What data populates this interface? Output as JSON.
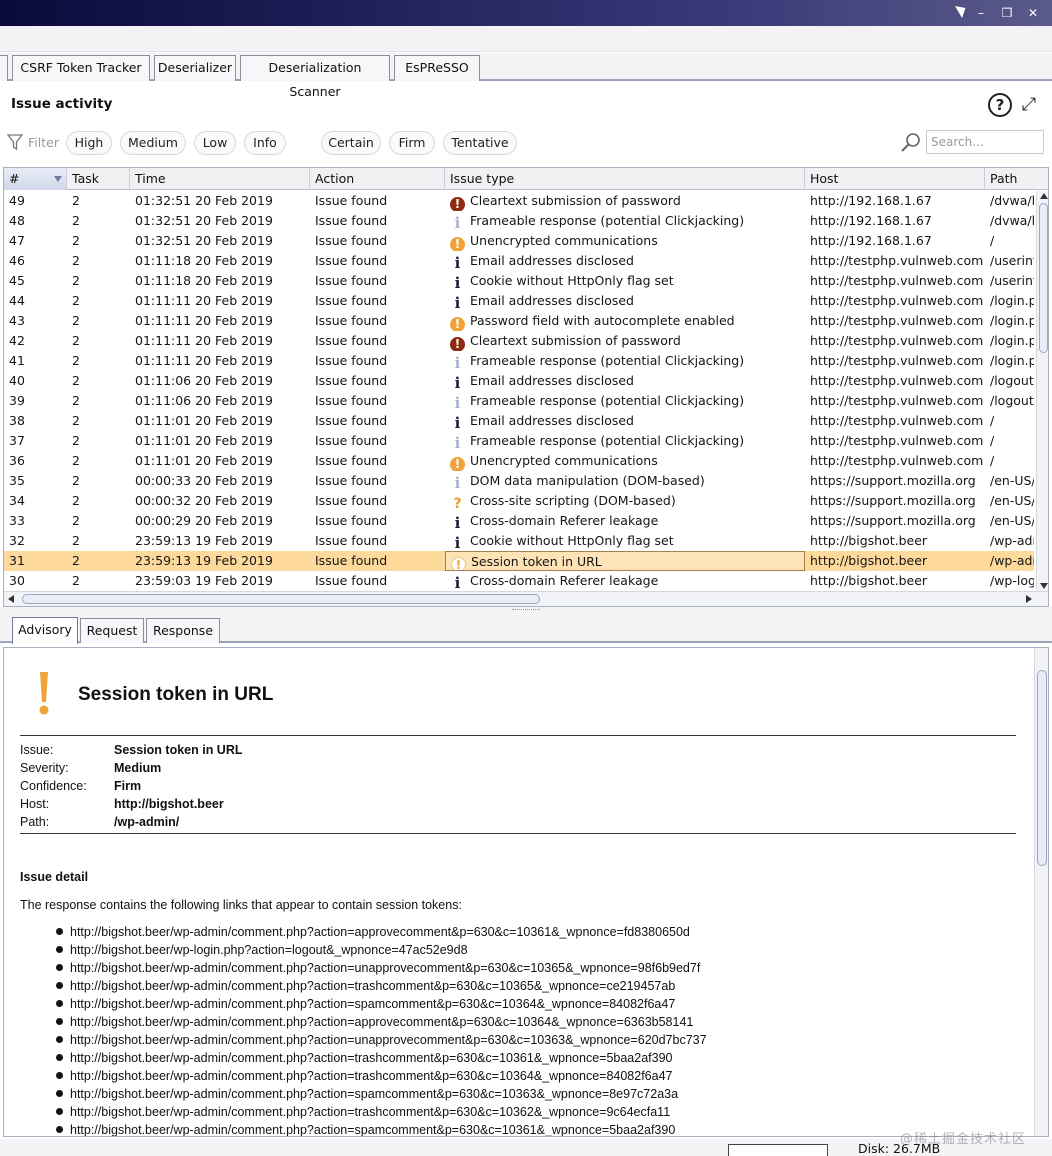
{
  "window": {
    "minimize": "–",
    "restore": "❐",
    "close": "✕"
  },
  "top_tabs": [
    "CSRF Token Tracker",
    "Deserializer",
    "Deserialization Scanner",
    "EsPReSSO"
  ],
  "issue_activity": {
    "title": "Issue activity",
    "help": "?",
    "expand": "⤢"
  },
  "filter": {
    "label": "Filter",
    "severity_chips": [
      "High",
      "Medium",
      "Low",
      "Info"
    ],
    "confidence_chips": [
      "Certain",
      "Firm",
      "Tentative"
    ],
    "search_placeholder": "Search..."
  },
  "table": {
    "columns": [
      "#",
      "Task",
      "Time",
      "Action",
      "Issue type",
      "Host",
      "Path"
    ],
    "sorted_column": "#",
    "selected_row": 31,
    "rows": [
      {
        "n": "49",
        "task": "2",
        "time": "01:32:51 20 Feb 2019",
        "action": "Issue found",
        "icon": "high",
        "type": "Cleartext submission of password",
        "host": "http://192.168.1.67",
        "path": "/dvwa/l"
      },
      {
        "n": "48",
        "task": "2",
        "time": "01:32:51 20 Feb 2019",
        "action": "Issue found",
        "icon": "info-light",
        "type": "Frameable response (potential Clickjacking)",
        "host": "http://192.168.1.67",
        "path": "/dvwa/l"
      },
      {
        "n": "47",
        "task": "2",
        "time": "01:32:51 20 Feb 2019",
        "action": "Issue found",
        "icon": "medium",
        "type": "Unencrypted communications",
        "host": "http://192.168.1.67",
        "path": "/"
      },
      {
        "n": "46",
        "task": "2",
        "time": "01:11:18 20 Feb 2019",
        "action": "Issue found",
        "icon": "info",
        "type": "Email addresses disclosed",
        "host": "http://testphp.vulnweb.com",
        "path": "/userinf"
      },
      {
        "n": "45",
        "task": "2",
        "time": "01:11:18 20 Feb 2019",
        "action": "Issue found",
        "icon": "info",
        "type": "Cookie without HttpOnly flag set",
        "host": "http://testphp.vulnweb.com",
        "path": "/userinf"
      },
      {
        "n": "44",
        "task": "2",
        "time": "01:11:11 20 Feb 2019",
        "action": "Issue found",
        "icon": "info",
        "type": "Email addresses disclosed",
        "host": "http://testphp.vulnweb.com",
        "path": "/login.p"
      },
      {
        "n": "43",
        "task": "2",
        "time": "01:11:11 20 Feb 2019",
        "action": "Issue found",
        "icon": "medium",
        "type": "Password field with autocomplete enabled",
        "host": "http://testphp.vulnweb.com",
        "path": "/login.p"
      },
      {
        "n": "42",
        "task": "2",
        "time": "01:11:11 20 Feb 2019",
        "action": "Issue found",
        "icon": "high",
        "type": "Cleartext submission of password",
        "host": "http://testphp.vulnweb.com",
        "path": "/login.p"
      },
      {
        "n": "41",
        "task": "2",
        "time": "01:11:11 20 Feb 2019",
        "action": "Issue found",
        "icon": "info-light",
        "type": "Frameable response (potential Clickjacking)",
        "host": "http://testphp.vulnweb.com",
        "path": "/login.p"
      },
      {
        "n": "40",
        "task": "2",
        "time": "01:11:06 20 Feb 2019",
        "action": "Issue found",
        "icon": "info",
        "type": "Email addresses disclosed",
        "host": "http://testphp.vulnweb.com",
        "path": "/logout."
      },
      {
        "n": "39",
        "task": "2",
        "time": "01:11:06 20 Feb 2019",
        "action": "Issue found",
        "icon": "info-light",
        "type": "Frameable response (potential Clickjacking)",
        "host": "http://testphp.vulnweb.com",
        "path": "/logout."
      },
      {
        "n": "38",
        "task": "2",
        "time": "01:11:01 20 Feb 2019",
        "action": "Issue found",
        "icon": "info",
        "type": "Email addresses disclosed",
        "host": "http://testphp.vulnweb.com",
        "path": "/"
      },
      {
        "n": "37",
        "task": "2",
        "time": "01:11:01 20 Feb 2019",
        "action": "Issue found",
        "icon": "info-light",
        "type": "Frameable response (potential Clickjacking)",
        "host": "http://testphp.vulnweb.com",
        "path": "/"
      },
      {
        "n": "36",
        "task": "2",
        "time": "01:11:01 20 Feb 2019",
        "action": "Issue found",
        "icon": "medium",
        "type": "Unencrypted communications",
        "host": "http://testphp.vulnweb.com",
        "path": "/"
      },
      {
        "n": "35",
        "task": "2",
        "time": "00:00:33 20 Feb 2019",
        "action": "Issue found",
        "icon": "info-light",
        "type": "DOM data manipulation (DOM-based)",
        "host": "https://support.mozilla.org",
        "path": "/en-US/"
      },
      {
        "n": "34",
        "task": "2",
        "time": "00:00:32 20 Feb 2019",
        "action": "Issue found",
        "icon": "tentative",
        "type": "Cross-site scripting (DOM-based)",
        "host": "https://support.mozilla.org",
        "path": "/en-US/"
      },
      {
        "n": "33",
        "task": "2",
        "time": "00:00:29 20 Feb 2019",
        "action": "Issue found",
        "icon": "info",
        "type": "Cross-domain Referer leakage",
        "host": "https://support.mozilla.org",
        "path": "/en-US/"
      },
      {
        "n": "32",
        "task": "2",
        "time": "23:59:13 19 Feb 2019",
        "action": "Issue found",
        "icon": "info",
        "type": "Cookie without HttpOnly flag set",
        "host": "http://bigshot.beer",
        "path": "/wp-adr"
      },
      {
        "n": "31",
        "task": "2",
        "time": "23:59:13 19 Feb 2019",
        "action": "Issue found",
        "icon": "white",
        "type": "Session token in URL",
        "host": "http://bigshot.beer",
        "path": "/wp-adr"
      },
      {
        "n": "30",
        "task": "2",
        "time": "23:59:03 19 Feb 2019",
        "action": "Issue found",
        "icon": "info",
        "type": "Cross-domain Referer leakage",
        "host": "http://bigshot.beer",
        "path": "/wp-logi"
      }
    ]
  },
  "detail_tabs": [
    "Advisory",
    "Request",
    "Response"
  ],
  "advisory": {
    "title": "Session token in URL",
    "meta": [
      {
        "label": "Issue:",
        "value": "Session token in URL"
      },
      {
        "label": "Severity:",
        "value": "Medium"
      },
      {
        "label": "Confidence:",
        "value": "Firm"
      },
      {
        "label": "Host:",
        "value": "http://bigshot.beer"
      },
      {
        "label": "Path:",
        "value": "/wp-admin/"
      }
    ],
    "detail_heading": "Issue detail",
    "detail_text": "The response contains the following links that appear to contain session tokens:",
    "links": [
      "http://bigshot.beer/wp-admin/comment.php?action=approvecomment&p=630&c=10361&_wpnonce=fd8380650d",
      "http://bigshot.beer/wp-login.php?action=logout&_wpnonce=47ac52e9d8",
      "http://bigshot.beer/wp-admin/comment.php?action=unapprovecomment&p=630&c=10365&_wpnonce=98f6b9ed7f",
      "http://bigshot.beer/wp-admin/comment.php?action=trashcomment&p=630&c=10365&_wpnonce=ce219457ab",
      "http://bigshot.beer/wp-admin/comment.php?action=spamcomment&p=630&c=10364&_wpnonce=84082f6a47",
      "http://bigshot.beer/wp-admin/comment.php?action=approvecomment&p=630&c=10364&_wpnonce=6363b58141",
      "http://bigshot.beer/wp-admin/comment.php?action=unapprovecomment&p=630&c=10363&_wpnonce=620d7bc737",
      "http://bigshot.beer/wp-admin/comment.php?action=trashcomment&p=630&c=10361&_wpnonce=5baa2af390",
      "http://bigshot.beer/wp-admin/comment.php?action=trashcomment&p=630&c=10364&_wpnonce=84082f6a47",
      "http://bigshot.beer/wp-admin/comment.php?action=spamcomment&p=630&c=10363&_wpnonce=8e97c72a3a",
      "http://bigshot.beer/wp-admin/comment.php?action=trashcomment&p=630&c=10362&_wpnonce=9c64ecfa11",
      "http://bigshot.beer/wp-admin/comment.php?action=spamcomment&p=630&c=10361&_wpnonce=5baa2af390"
    ]
  },
  "status": {
    "disk": "Disk: 26.7MB"
  },
  "watermark": "@稀土掘金技术社区",
  "colors": {
    "selected_row": "#fdd99c",
    "high": "#8f2a12",
    "medium": "#f0a33b"
  }
}
